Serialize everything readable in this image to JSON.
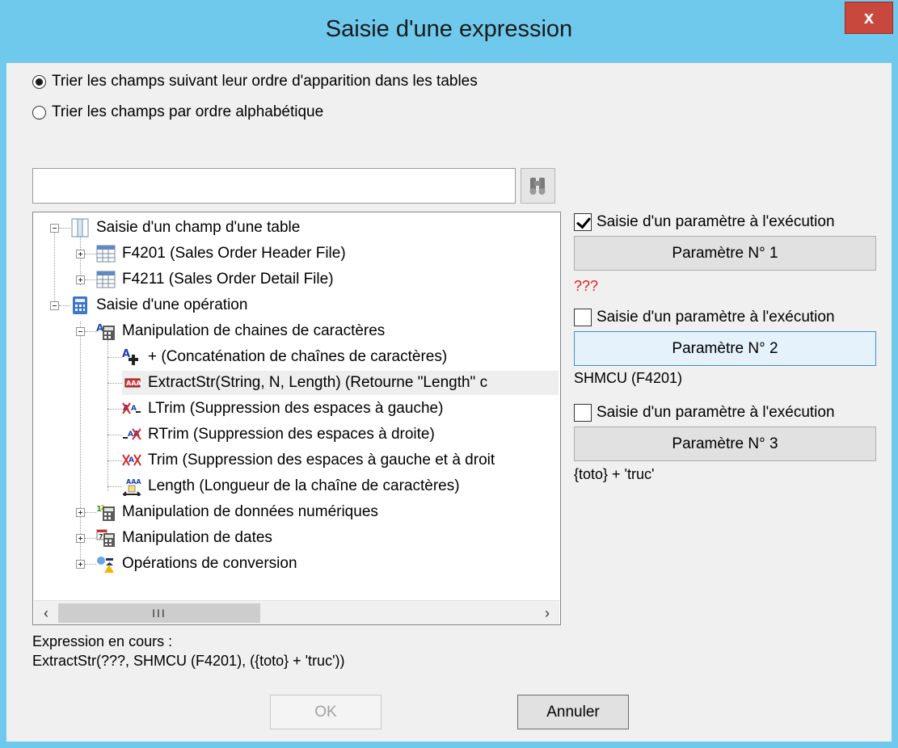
{
  "window": {
    "title": "Saisie d'une expression",
    "close_label": "x"
  },
  "sort_options": [
    {
      "label": "Trier les champs suivant leur ordre d'apparition dans les tables",
      "selected": true
    },
    {
      "label": "Trier les champs par ordre alphabétique",
      "selected": false
    }
  ],
  "search": {
    "value": "",
    "placeholder": ""
  },
  "tree": {
    "items": [
      {
        "label": "Saisie d'un champ d'une table"
      },
      {
        "label": "F4201 (Sales Order Header File)"
      },
      {
        "label": "F4211 (Sales Order Detail File)"
      },
      {
        "label": "Saisie d'une opération"
      },
      {
        "label": "Manipulation de chaines de caractères"
      },
      {
        "label": "+ (Concaténation de chaînes de caractères)"
      },
      {
        "label": "ExtractStr(String, N, Length) (Retourne \"Length\" c"
      },
      {
        "label": "LTrim (Suppression des espaces à gauche)"
      },
      {
        "label": "RTrim (Suppression des espaces à droite)"
      },
      {
        "label": "Trim (Suppression des espaces à gauche et à droit"
      },
      {
        "label": "Length (Longueur de la chaîne de caractères)"
      },
      {
        "label": "Manipulation de données numériques"
      },
      {
        "label": "Manipulation de dates"
      },
      {
        "label": "Opérations de conversion"
      }
    ],
    "scroll_thumb": "III"
  },
  "params": [
    {
      "check_label": "Saisie d'un paramètre à l'exécution",
      "checked": true,
      "button": "Paramètre N° 1",
      "value": "???"
    },
    {
      "check_label": "Saisie d'un paramètre à l'exécution",
      "checked": false,
      "button": "Paramètre N° 2",
      "value": "SHMCU (F4201)"
    },
    {
      "check_label": "Saisie d'un paramètre à l'exécution",
      "checked": false,
      "button": "Paramètre N° 3",
      "value": "{toto} + 'truc'"
    }
  ],
  "expression": {
    "label": "Expression en cours :",
    "value": "ExtractStr(???, SHMCU (F4201), ({toto} + 'truc'))"
  },
  "buttons": {
    "ok": "OK",
    "cancel": "Annuler"
  },
  "colors": {
    "title_bar": "#6ec9ec",
    "close": "#c9483d",
    "error_text": "#e02020"
  }
}
